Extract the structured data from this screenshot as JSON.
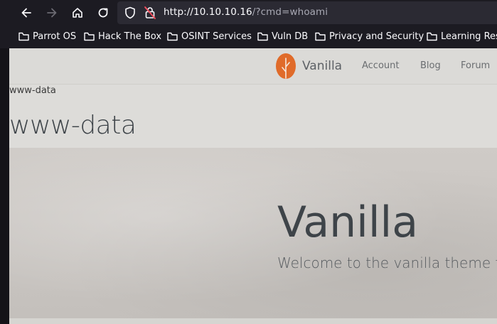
{
  "browser": {
    "url_host": "http://10.10.10.16",
    "url_path": "/?cmd=whoami",
    "bookmarks": [
      "Parrot OS",
      "Hack The Box",
      "OSINT Services",
      "Vuln DB",
      "Privacy and Security",
      "Learning Res"
    ]
  },
  "site": {
    "brand": "Vanilla",
    "menu": [
      "Account",
      "Blog",
      "Forum"
    ],
    "accent": "#e06b2a"
  },
  "command_output": "www-data",
  "page_title": "www-data",
  "hero": {
    "title": "Vanilla",
    "subtitle": "Welcome to the vanilla theme for C"
  }
}
